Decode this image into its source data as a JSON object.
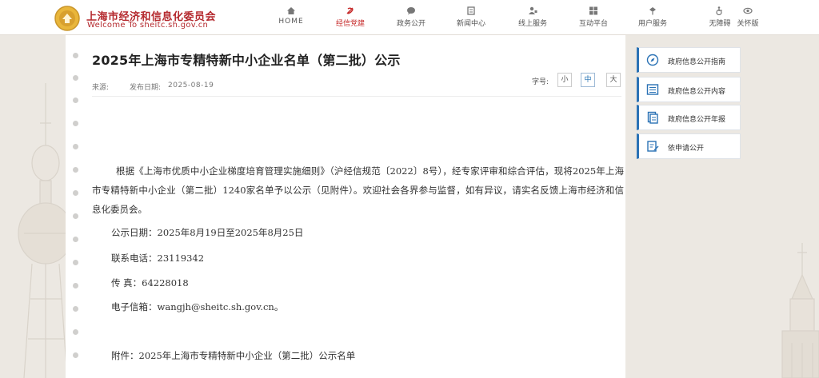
{
  "header": {
    "brand_cn": "上海市经济和信息化委员会",
    "brand_en": "Welcome To sheitc.sh.gov.cn",
    "nav": [
      {
        "label": "HOME",
        "icon": "home-icon"
      },
      {
        "label": "经信党建",
        "icon": "party-emblem-icon",
        "active": true
      },
      {
        "label": "政务公开",
        "icon": "chat-bubble-icon"
      },
      {
        "label": "新闻中心",
        "icon": "newspaper-icon"
      },
      {
        "label": "线上服务",
        "icon": "person-service-icon"
      },
      {
        "label": "互动平台",
        "icon": "grid-icon"
      },
      {
        "label": "用户服务",
        "icon": "user-icon"
      },
      {
        "label": "无障碍",
        "icon": "wheelchair-icon"
      },
      {
        "label": "关怀版",
        "icon": "eye-icon"
      }
    ],
    "accent_color": "#c62828"
  },
  "article": {
    "title": "2025年上海市专精特新中小企业名单（第二批）公示",
    "source_label": "来源:",
    "date_label": "发布日期:",
    "date": "2025-08-19",
    "font_size_label": "字号:",
    "font_sizes": [
      "小",
      "中",
      "大"
    ],
    "paragraph": "根据《上海市优质中小企业梯度培育管理实施细则》（沪经信规范〔2022〕8号），经专家评审和综合评估，现将2025年上海市专精特新中小企业（第二批）1240家名单予以公示（见附件）。欢迎社会各界参与监督，如有异议，请实名反馈上海市经济和信息化委员会。",
    "notice_date": "公示日期：2025年8月19日至2025年8月25日",
    "phone": "联系电话：23119342",
    "fax": "传 真：64228018",
    "email": "电子信箱：wangjh@sheitc.sh.gov.cn。",
    "attachment": "附件：2025年上海市专精特新中小企业（第二批）公示名单"
  },
  "sidebar": {
    "items": [
      {
        "label": "政府信息公开指南",
        "icon": "compass-icon"
      },
      {
        "label": "政府信息公开内容",
        "icon": "list-icon"
      },
      {
        "label": "政府信息公开年报",
        "icon": "report-icon"
      },
      {
        "label": "依申请公开",
        "icon": "edit-form-icon"
      }
    ],
    "accent_color": "#2a72b5"
  }
}
